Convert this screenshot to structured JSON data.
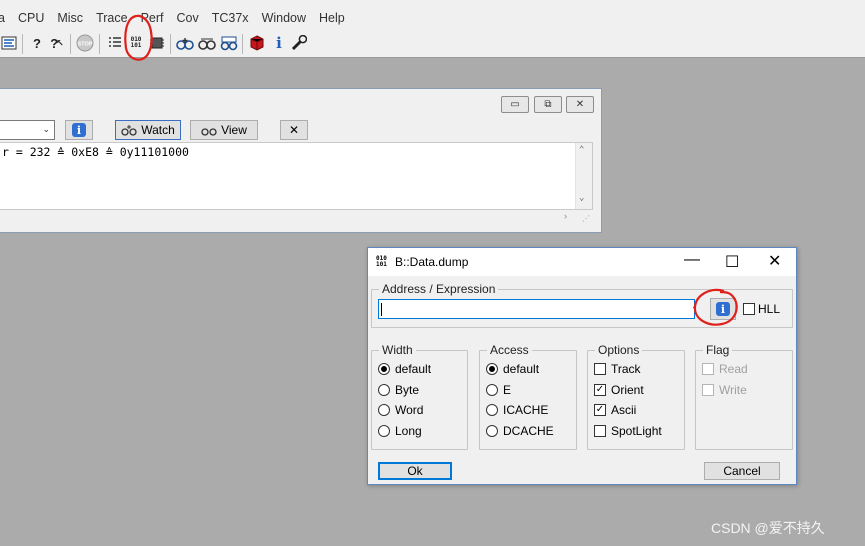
{
  "menu": [
    "CPU",
    "Misc",
    "Trace",
    "Perf",
    "Cov",
    "TC37x",
    "Window",
    "Help"
  ],
  "menu_cut": "a",
  "toolbar": {
    "icons": [
      "mnu-icon",
      "help-icon",
      "context-help-icon",
      "stop-icon",
      "list-icon",
      "data-dump-icon",
      "chip-icon",
      "glasses-add-icon",
      "glasses-icon",
      "glasses-edit-icon",
      "red-cube-icon",
      "info-icon",
      "wrench-icon"
    ],
    "stop_label": "STOP",
    "dump_label": "010\n101"
  },
  "watch_window": {
    "watch_label": "Watch",
    "view_label": "View",
    "content_line": "r = 232 ≙ 0xE8 ≙ 0y11101000"
  },
  "dialog": {
    "title": "B::Data.dump",
    "address_legend": "Address / Expression",
    "address_value": "",
    "hll_label": "HLL",
    "width": {
      "legend": "Width",
      "options": [
        {
          "label": "default",
          "selected": true
        },
        {
          "label": "Byte",
          "selected": false
        },
        {
          "label": "Word",
          "selected": false
        },
        {
          "label": "Long",
          "selected": false
        }
      ]
    },
    "access": {
      "legend": "Access",
      "options": [
        {
          "label": "default",
          "selected": true
        },
        {
          "label": "E",
          "selected": false
        },
        {
          "label": "ICACHE",
          "selected": false
        },
        {
          "label": "DCACHE",
          "selected": false
        }
      ]
    },
    "options": {
      "legend": "Options",
      "items": [
        {
          "label": "Track",
          "checked": false
        },
        {
          "label": "Orient",
          "checked": true
        },
        {
          "label": "Ascii",
          "checked": true
        },
        {
          "label": "SpotLight",
          "checked": false
        }
      ]
    },
    "flag": {
      "legend": "Flag",
      "items": [
        {
          "label": "Read",
          "checked": false
        },
        {
          "label": "Write",
          "checked": false
        }
      ]
    },
    "ok_label": "Ok",
    "cancel_label": "Cancel"
  },
  "annotation_color": "#e0201a",
  "watermark": "CSDN @爱不持久"
}
